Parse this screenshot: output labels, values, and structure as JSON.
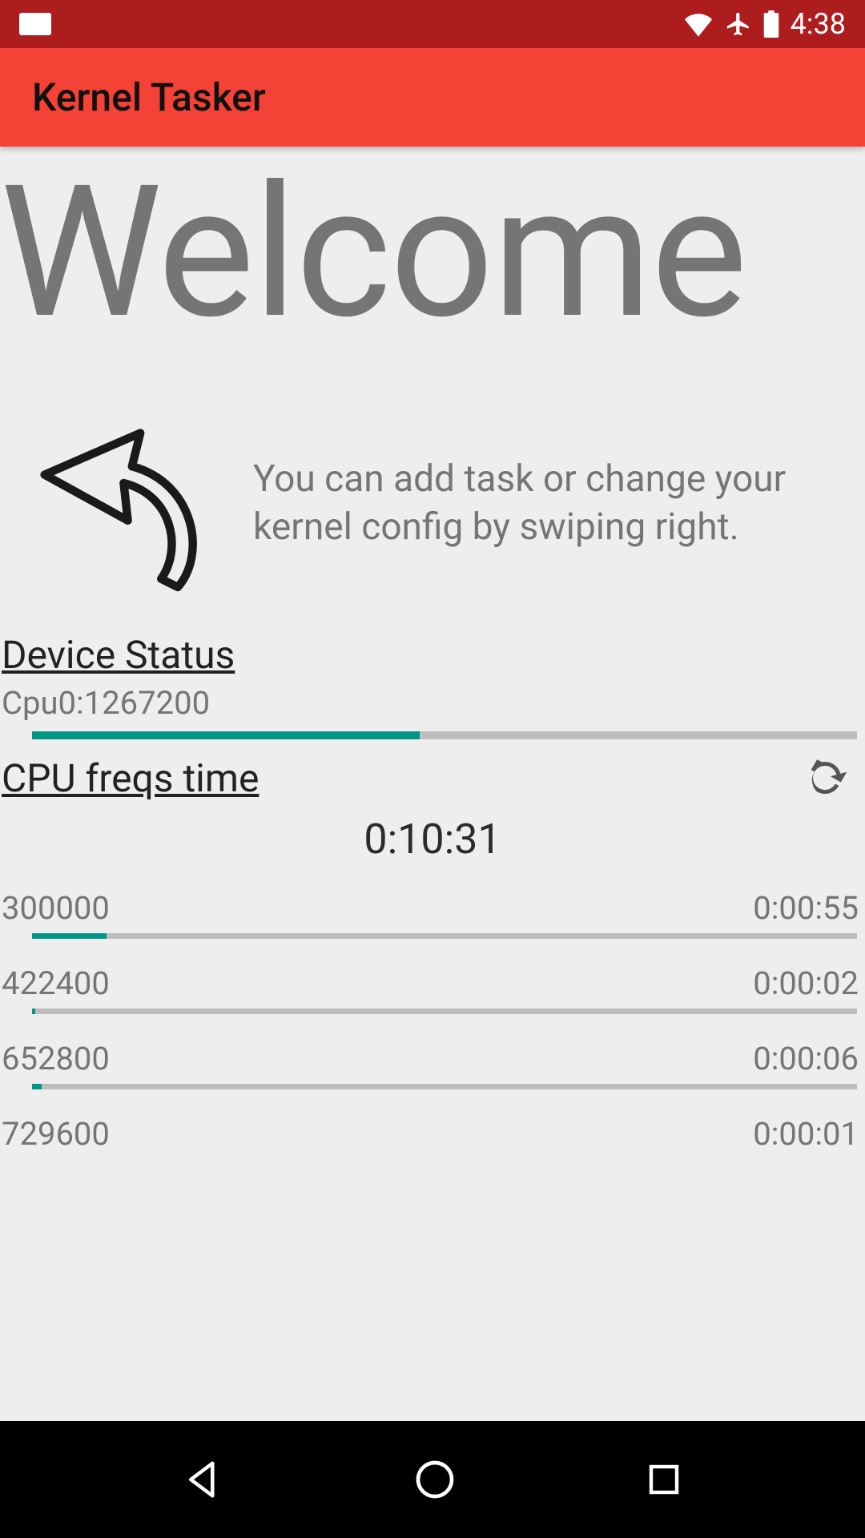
{
  "status": {
    "time": "4:38"
  },
  "app": {
    "title": "Kernel Tasker"
  },
  "welcome": {
    "heading": "Welcome",
    "hint": "You can add task or change your kernel config by swiping right."
  },
  "device_status": {
    "section_label": "Device Status",
    "cpu_label": "Cpu0:1267200",
    "cpu_progress_percent": 47
  },
  "cpu_freqs": {
    "section_label": "CPU freqs time",
    "total_time": "0:10:31",
    "rows": [
      {
        "freq": "300000",
        "time": "0:00:55",
        "percent": 9
      },
      {
        "freq": "422400",
        "time": "0:00:02",
        "percent": 0.4
      },
      {
        "freq": "652800",
        "time": "0:00:06",
        "percent": 1.2
      },
      {
        "freq": "729600",
        "time": "0:00:01",
        "percent": 0.2
      }
    ]
  }
}
